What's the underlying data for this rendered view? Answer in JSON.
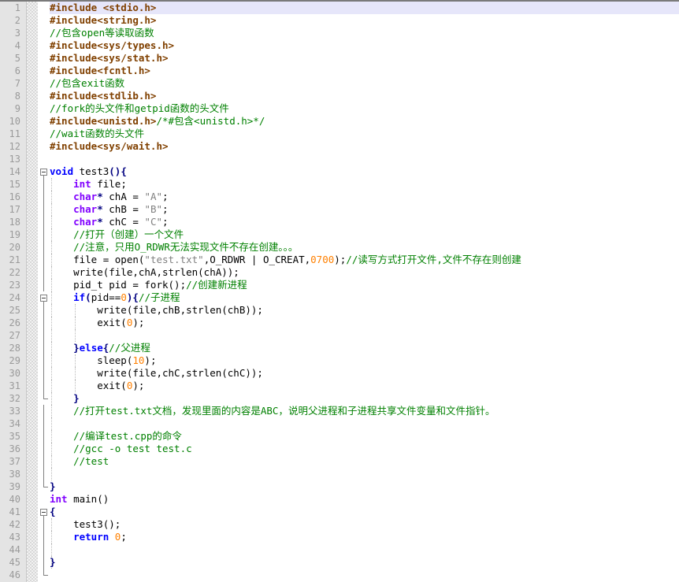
{
  "editor": {
    "name": "source-code-editor",
    "language": "C",
    "total_lines": 46,
    "current_line": 1,
    "colors": {
      "background": "#ffffff",
      "gutter": "#e4e4e4",
      "current_line_highlight": "#e6e6fa",
      "preprocessor": "#804000",
      "comment": "#008000",
      "keyword": "#0000ff",
      "type": "#8000ff",
      "number": "#ff8000",
      "string": "#808080",
      "operator": "#000080",
      "line_number": "#9a9a9a"
    }
  },
  "lines": [
    {
      "n": 1,
      "indent": 0,
      "fold": "none",
      "current": true,
      "tokens": [
        {
          "c": "pre",
          "t": "#include <stdio.h>"
        }
      ]
    },
    {
      "n": 2,
      "indent": 0,
      "fold": "none",
      "tokens": [
        {
          "c": "pre",
          "t": "#include<string.h>"
        }
      ]
    },
    {
      "n": 3,
      "indent": 0,
      "fold": "none",
      "tokens": [
        {
          "c": "cmt",
          "t": "//包含open等读取函数"
        }
      ]
    },
    {
      "n": 4,
      "indent": 0,
      "fold": "none",
      "tokens": [
        {
          "c": "pre",
          "t": "#include<sys/types.h>"
        }
      ]
    },
    {
      "n": 5,
      "indent": 0,
      "fold": "none",
      "tokens": [
        {
          "c": "pre",
          "t": "#include<sys/stat.h>"
        }
      ]
    },
    {
      "n": 6,
      "indent": 0,
      "fold": "none",
      "tokens": [
        {
          "c": "pre",
          "t": "#include<fcntl.h>"
        }
      ]
    },
    {
      "n": 7,
      "indent": 0,
      "fold": "none",
      "tokens": [
        {
          "c": "cmt",
          "t": "//包含exit函数"
        }
      ]
    },
    {
      "n": 8,
      "indent": 0,
      "fold": "none",
      "tokens": [
        {
          "c": "pre",
          "t": "#include<stdlib.h>"
        }
      ]
    },
    {
      "n": 9,
      "indent": 0,
      "fold": "none",
      "tokens": [
        {
          "c": "cmt",
          "t": "//fork的头文件和getpid函数的头文件"
        }
      ]
    },
    {
      "n": 10,
      "indent": 0,
      "fold": "none",
      "tokens": [
        {
          "c": "pre",
          "t": "#include<unistd.h>"
        },
        {
          "c": "cmt",
          "t": "/*#包含<unistd.h>*/"
        }
      ]
    },
    {
      "n": 11,
      "indent": 0,
      "fold": "none",
      "tokens": [
        {
          "c": "cmt",
          "t": "//wait函数的头文件"
        }
      ]
    },
    {
      "n": 12,
      "indent": 0,
      "fold": "none",
      "tokens": [
        {
          "c": "pre",
          "t": "#include<sys/wait.h>"
        }
      ]
    },
    {
      "n": 13,
      "indent": 0,
      "fold": "none",
      "tokens": []
    },
    {
      "n": 14,
      "indent": 0,
      "fold": "start",
      "tokens": [
        {
          "c": "kw",
          "t": "void"
        },
        {
          "c": "plain",
          "t": " test3"
        },
        {
          "c": "op",
          "t": "(){"
        }
      ]
    },
    {
      "n": 15,
      "indent": 1,
      "fold": "line",
      "tokens": [
        {
          "c": "plain",
          "t": "    "
        },
        {
          "c": "type",
          "t": "int"
        },
        {
          "c": "plain",
          "t": " file;"
        }
      ]
    },
    {
      "n": 16,
      "indent": 1,
      "fold": "line",
      "tokens": [
        {
          "c": "plain",
          "t": "    "
        },
        {
          "c": "type",
          "t": "char"
        },
        {
          "c": "op",
          "t": "*"
        },
        {
          "c": "plain",
          "t": " chA = "
        },
        {
          "c": "str",
          "t": "\"A\""
        },
        {
          "c": "plain",
          "t": ";"
        }
      ]
    },
    {
      "n": 17,
      "indent": 1,
      "fold": "line",
      "tokens": [
        {
          "c": "plain",
          "t": "    "
        },
        {
          "c": "type",
          "t": "char"
        },
        {
          "c": "op",
          "t": "*"
        },
        {
          "c": "plain",
          "t": " chB = "
        },
        {
          "c": "str",
          "t": "\"B\""
        },
        {
          "c": "plain",
          "t": ";"
        }
      ]
    },
    {
      "n": 18,
      "indent": 1,
      "fold": "line",
      "tokens": [
        {
          "c": "plain",
          "t": "    "
        },
        {
          "c": "type",
          "t": "char"
        },
        {
          "c": "op",
          "t": "*"
        },
        {
          "c": "plain",
          "t": " chC = "
        },
        {
          "c": "str",
          "t": "\"C\""
        },
        {
          "c": "plain",
          "t": ";"
        }
      ]
    },
    {
      "n": 19,
      "indent": 1,
      "fold": "line",
      "tokens": [
        {
          "c": "plain",
          "t": "    "
        },
        {
          "c": "cmt",
          "t": "//打开（创建）一个文件"
        }
      ]
    },
    {
      "n": 20,
      "indent": 1,
      "fold": "line",
      "tokens": [
        {
          "c": "plain",
          "t": "    "
        },
        {
          "c": "cmt",
          "t": "//注意，只用O_RDWR无法实现文件不存在创建。。。"
        }
      ]
    },
    {
      "n": 21,
      "indent": 1,
      "fold": "line",
      "tokens": [
        {
          "c": "plain",
          "t": "    file = open("
        },
        {
          "c": "str",
          "t": "\"test.txt\""
        },
        {
          "c": "plain",
          "t": ",O_RDWR | O_CREAT,"
        },
        {
          "c": "num",
          "t": "0700"
        },
        {
          "c": "plain",
          "t": ");"
        },
        {
          "c": "cmt",
          "t": "//读写方式打开文件,文件不存在则创建"
        }
      ]
    },
    {
      "n": 22,
      "indent": 1,
      "fold": "line",
      "tokens": [
        {
          "c": "plain",
          "t": "    write(file,chA,strlen(chA));"
        }
      ]
    },
    {
      "n": 23,
      "indent": 1,
      "fold": "line",
      "tokens": [
        {
          "c": "plain",
          "t": "    pid_t pid = fork();"
        },
        {
          "c": "cmt",
          "t": "//创建新进程"
        }
      ]
    },
    {
      "n": 24,
      "indent": 1,
      "fold": "start-inner",
      "tokens": [
        {
          "c": "plain",
          "t": "    "
        },
        {
          "c": "kw",
          "t": "if"
        },
        {
          "c": "op",
          "t": "("
        },
        {
          "c": "plain",
          "t": "pid=="
        },
        {
          "c": "num",
          "t": "0"
        },
        {
          "c": "op",
          "t": "){"
        },
        {
          "c": "cmt",
          "t": "//子进程"
        }
      ]
    },
    {
      "n": 25,
      "indent": 2,
      "fold": "line-inner",
      "tokens": [
        {
          "c": "plain",
          "t": "        write(file,chB,strlen(chB));"
        }
      ]
    },
    {
      "n": 26,
      "indent": 2,
      "fold": "line-inner",
      "tokens": [
        {
          "c": "plain",
          "t": "        exit("
        },
        {
          "c": "num",
          "t": "0"
        },
        {
          "c": "plain",
          "t": ");"
        }
      ]
    },
    {
      "n": 27,
      "indent": 2,
      "fold": "line-inner",
      "tokens": []
    },
    {
      "n": 28,
      "indent": 1,
      "fold": "line-inner",
      "tokens": [
        {
          "c": "op",
          "t": "    }"
        },
        {
          "c": "kw",
          "t": "else"
        },
        {
          "c": "op",
          "t": "{"
        },
        {
          "c": "cmt",
          "t": "//父进程"
        }
      ]
    },
    {
      "n": 29,
      "indent": 2,
      "fold": "line-inner",
      "tokens": [
        {
          "c": "plain",
          "t": "        sleep("
        },
        {
          "c": "num",
          "t": "10"
        },
        {
          "c": "plain",
          "t": ");"
        }
      ]
    },
    {
      "n": 30,
      "indent": 2,
      "fold": "line-inner",
      "tokens": [
        {
          "c": "plain",
          "t": "        write(file,chC,strlen(chC));"
        }
      ]
    },
    {
      "n": 31,
      "indent": 2,
      "fold": "line-inner",
      "tokens": [
        {
          "c": "plain",
          "t": "        exit("
        },
        {
          "c": "num",
          "t": "0"
        },
        {
          "c": "plain",
          "t": ");"
        }
      ]
    },
    {
      "n": 32,
      "indent": 1,
      "fold": "end-inner",
      "tokens": [
        {
          "c": "op",
          "t": "    }"
        }
      ]
    },
    {
      "n": 33,
      "indent": 1,
      "fold": "line",
      "tokens": [
        {
          "c": "plain",
          "t": "    "
        },
        {
          "c": "cmt",
          "t": "//打开test.txt文档，发现里面的内容是ABC，说明父进程和子进程共享文件变量和文件指针。"
        }
      ]
    },
    {
      "n": 34,
      "indent": 1,
      "fold": "line",
      "tokens": []
    },
    {
      "n": 35,
      "indent": 1,
      "fold": "line",
      "tokens": [
        {
          "c": "plain",
          "t": "    "
        },
        {
          "c": "cmt",
          "t": "//编译test.cpp的命令"
        }
      ]
    },
    {
      "n": 36,
      "indent": 1,
      "fold": "line",
      "tokens": [
        {
          "c": "plain",
          "t": "    "
        },
        {
          "c": "cmt",
          "t": "//gcc -o test test.c"
        }
      ]
    },
    {
      "n": 37,
      "indent": 1,
      "fold": "line",
      "tokens": [
        {
          "c": "plain",
          "t": "    "
        },
        {
          "c": "cmt",
          "t": "//test"
        }
      ]
    },
    {
      "n": 38,
      "indent": 1,
      "fold": "line",
      "tokens": []
    },
    {
      "n": 39,
      "indent": 0,
      "fold": "end",
      "tokens": [
        {
          "c": "op",
          "t": "}"
        }
      ]
    },
    {
      "n": 40,
      "indent": 0,
      "fold": "none",
      "tokens": [
        {
          "c": "type",
          "t": "int"
        },
        {
          "c": "plain",
          "t": " main()"
        }
      ]
    },
    {
      "n": 41,
      "indent": 0,
      "fold": "start",
      "tokens": [
        {
          "c": "op",
          "t": "{"
        }
      ]
    },
    {
      "n": 42,
      "indent": 1,
      "fold": "line",
      "tokens": [
        {
          "c": "plain",
          "t": "    test3();"
        }
      ]
    },
    {
      "n": 43,
      "indent": 1,
      "fold": "line",
      "tokens": [
        {
          "c": "plain",
          "t": "    "
        },
        {
          "c": "kw",
          "t": "return"
        },
        {
          "c": "plain",
          "t": " "
        },
        {
          "c": "num",
          "t": "0"
        },
        {
          "c": "plain",
          "t": ";"
        }
      ]
    },
    {
      "n": 44,
      "indent": 1,
      "fold": "line",
      "tokens": []
    },
    {
      "n": 45,
      "indent": 1,
      "fold": "line",
      "tokens": [
        {
          "c": "op",
          "t": "}"
        }
      ]
    },
    {
      "n": 46,
      "indent": 0,
      "fold": "end",
      "tokens": []
    }
  ]
}
